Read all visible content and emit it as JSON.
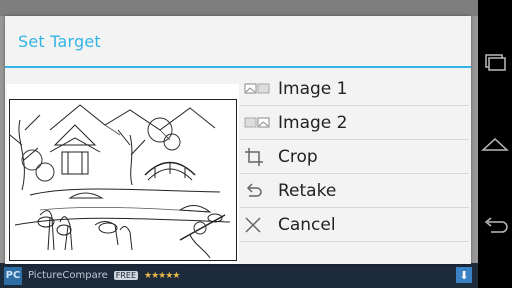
{
  "background_app": {
    "ad_bar": {
      "logo": "PC",
      "name": "PictureCompare",
      "badge": "FREE",
      "stars": "★★★★★"
    }
  },
  "dialog": {
    "title": "Set Target",
    "accent_color": "#33b5e5",
    "menu": [
      {
        "label": "Image 1",
        "icon": "image-pair-icon"
      },
      {
        "label": "Image 2",
        "icon": "image-pair-icon"
      },
      {
        "label": "Crop",
        "icon": "crop-icon"
      },
      {
        "label": "Retake",
        "icon": "undo-icon"
      },
      {
        "label": "Cancel",
        "icon": "close-icon"
      }
    ]
  },
  "nav": {
    "buttons": [
      "recents-icon",
      "home-icon",
      "back-icon"
    ]
  }
}
